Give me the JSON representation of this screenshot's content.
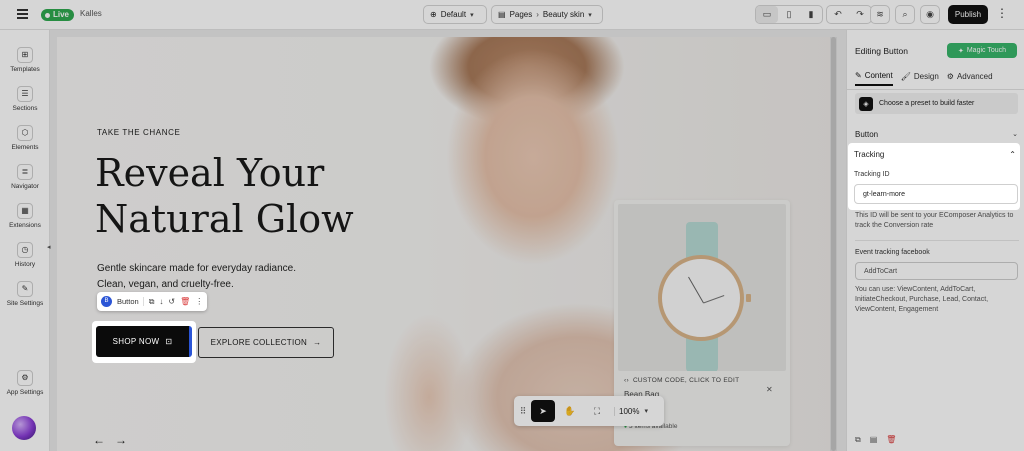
{
  "topbar": {
    "status": "Live",
    "store_name": "Kalles",
    "template": "Default",
    "pages_label": "Pages",
    "page_name": "Beauty skin",
    "publish_label": "Publish"
  },
  "sidebar": {
    "items": [
      {
        "label": "Templates",
        "icon": "templates-icon"
      },
      {
        "label": "Sections",
        "icon": "sections-icon"
      },
      {
        "label": "Elements",
        "icon": "elements-icon"
      },
      {
        "label": "Navigator",
        "icon": "navigator-icon"
      },
      {
        "label": "Extensions",
        "icon": "extensions-icon"
      },
      {
        "label": "History",
        "icon": "history-icon"
      },
      {
        "label": "Site Settings",
        "icon": "site-settings-icon"
      },
      {
        "label": "App Settings",
        "icon": "app-settings-icon"
      }
    ]
  },
  "hero": {
    "eyebrow": "TAKE THE CHANCE",
    "title_line1": "Reveal Your",
    "title_line2": "Natural Glow",
    "sub_line1": "Gentle skincare made for everyday radiance.",
    "sub_line2": "Clean, vegan, and cruelty-free.",
    "primary_cta": "SHOP NOW",
    "secondary_cta": "EXPLORE COLLECTION"
  },
  "element_toolbar": {
    "badge": "B",
    "label": "Button"
  },
  "product_card": {
    "custom_code": "CUSTOM CODE, CLICK TO EDIT",
    "title": "Bean Bag",
    "stock": "3 items available"
  },
  "canvas_tools": {
    "zoom": "100%"
  },
  "panel": {
    "title": "Editing Button",
    "magic_label": "Magic Touch",
    "tabs": [
      "Content",
      "Design",
      "Advanced"
    ],
    "preset_label": "Choose a preset to build faster",
    "button_section": "Button",
    "tracking_section": "Tracking",
    "tracking_id_label": "Tracking ID",
    "tracking_id_value": "gt-learn-more",
    "tracking_note": "This ID will be sent to your EComposer Analytics to track the Conversion rate",
    "event_label": "Event tracking facebook",
    "event_value": "AddToCart",
    "event_note": "You can use: ViewContent, AddToCart, InitiateCheckout, Purchase, Lead, Contact, ViewContent, Engagement"
  },
  "colors": {
    "accent_green": "#2fa84f",
    "magic_green": "#39b66a",
    "selection_blue": "#2b55d6",
    "delete_red": "#d93a3a"
  }
}
